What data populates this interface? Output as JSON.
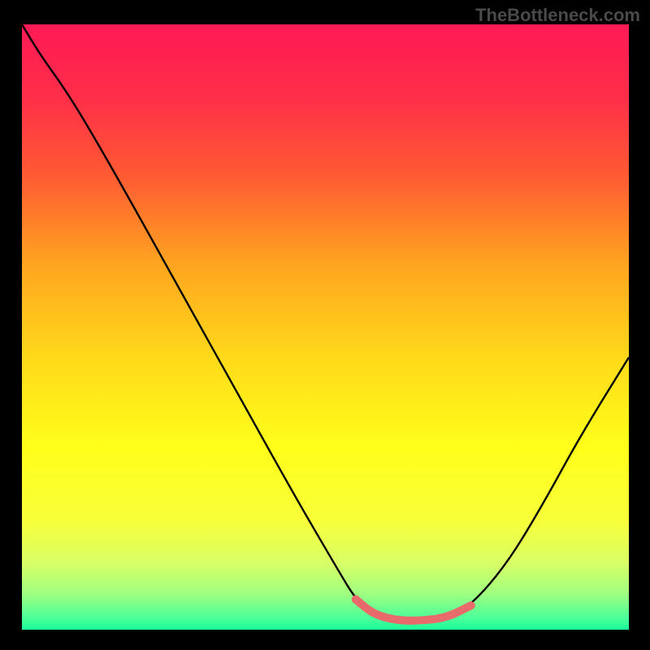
{
  "watermark": "TheBottleneck.com",
  "chart_data": {
    "type": "line",
    "title": "",
    "xlabel": "",
    "ylabel": "",
    "xlim": [
      0,
      100
    ],
    "ylim": [
      0,
      100
    ],
    "gradient_stops": [
      {
        "offset": 0.0,
        "color": "#ff1a55"
      },
      {
        "offset": 0.12,
        "color": "#ff2e49"
      },
      {
        "offset": 0.25,
        "color": "#ff5a33"
      },
      {
        "offset": 0.4,
        "color": "#ffa61f"
      },
      {
        "offset": 0.55,
        "color": "#ffd91a"
      },
      {
        "offset": 0.7,
        "color": "#ffff1a"
      },
      {
        "offset": 0.82,
        "color": "#f8ff3a"
      },
      {
        "offset": 0.89,
        "color": "#d8ff66"
      },
      {
        "offset": 0.94,
        "color": "#a0ff80"
      },
      {
        "offset": 0.98,
        "color": "#4dff99"
      },
      {
        "offset": 1.0,
        "color": "#1aff99"
      }
    ],
    "series": [
      {
        "name": "bottleneck-curve",
        "stroke": "#000000",
        "width": 2.4,
        "points": [
          {
            "x": 0.0,
            "y": 100.0
          },
          {
            "x": 3.0,
            "y": 95.0
          },
          {
            "x": 8.0,
            "y": 88.0
          },
          {
            "x": 15.0,
            "y": 76.0
          },
          {
            "x": 25.0,
            "y": 58.0
          },
          {
            "x": 35.0,
            "y": 40.0
          },
          {
            "x": 45.0,
            "y": 22.0
          },
          {
            "x": 52.0,
            "y": 10.0
          },
          {
            "x": 55.0,
            "y": 5.0
          },
          {
            "x": 58.0,
            "y": 2.5
          },
          {
            "x": 62.0,
            "y": 1.5
          },
          {
            "x": 66.0,
            "y": 1.5
          },
          {
            "x": 70.0,
            "y": 2.0
          },
          {
            "x": 74.0,
            "y": 4.0
          },
          {
            "x": 80.0,
            "y": 11.0
          },
          {
            "x": 86.0,
            "y": 21.0
          },
          {
            "x": 92.0,
            "y": 32.0
          },
          {
            "x": 100.0,
            "y": 45.0
          }
        ]
      },
      {
        "name": "highlight-segment",
        "stroke": "#e86a6a",
        "width": 10,
        "points": [
          {
            "x": 55.0,
            "y": 5.0
          },
          {
            "x": 58.0,
            "y": 2.5
          },
          {
            "x": 62.0,
            "y": 1.5
          },
          {
            "x": 66.0,
            "y": 1.5
          },
          {
            "x": 70.0,
            "y": 2.0
          },
          {
            "x": 74.0,
            "y": 4.0
          }
        ]
      }
    ],
    "dot": {
      "x": 55.0,
      "y": 5.0,
      "r": 5,
      "color": "#e86a6a"
    }
  }
}
